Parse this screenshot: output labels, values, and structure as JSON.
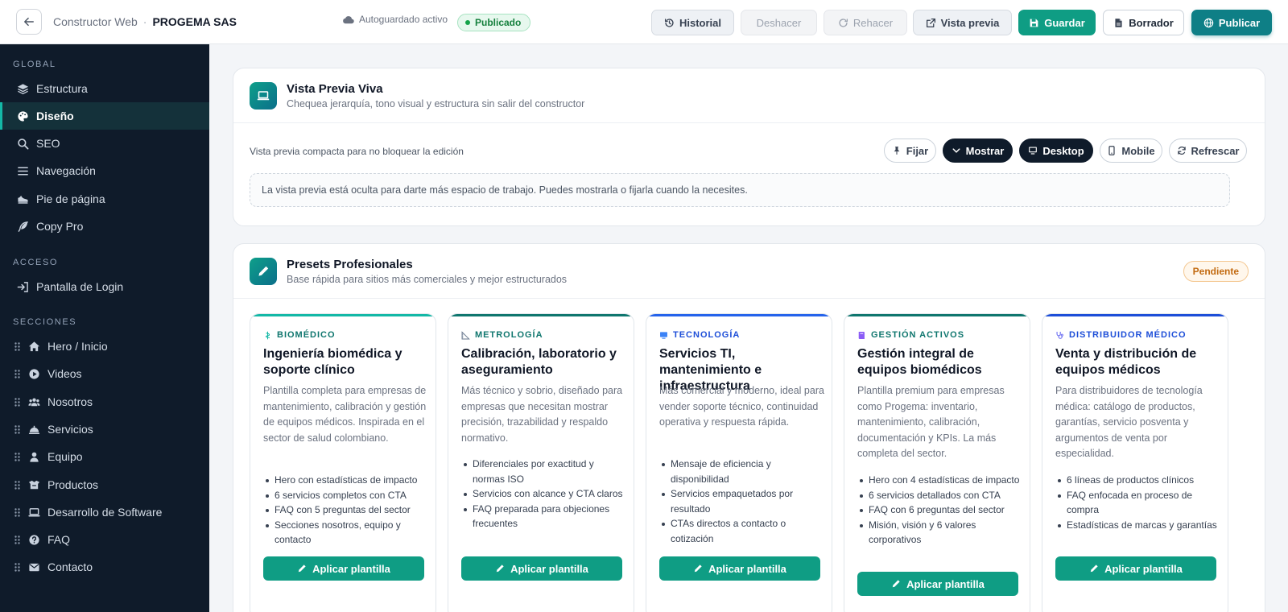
{
  "topbar": {
    "app_name": "Constructor Web",
    "separator": "·",
    "org_name": "PROGEMA SAS",
    "autosave_text": "Autoguardado activo",
    "status_badge": "Publicado",
    "buttons": {
      "history": "Historial",
      "undo": "Deshacer",
      "redo": "Rehacer",
      "preview": "Vista previa",
      "save": "Guardar",
      "draft": "Borrador",
      "publish": "Publicar"
    }
  },
  "sidebar": {
    "global_title": "GLOBAL",
    "global_items": [
      {
        "label": "Estructura",
        "icon": "layers-icon"
      },
      {
        "label": "Diseño",
        "icon": "palette-icon",
        "active": true
      },
      {
        "label": "SEO",
        "icon": "search-icon"
      },
      {
        "label": "Navegación",
        "icon": "menu-icon"
      },
      {
        "label": "Pie de página",
        "icon": "shoe-icon"
      },
      {
        "label": "Copy Pro",
        "icon": "feather-icon"
      }
    ],
    "access_title": "ACCESO",
    "access_items": [
      {
        "label": "Pantalla de Login",
        "icon": "login-icon"
      }
    ],
    "sections_title": "SECCIONES",
    "section_items": [
      {
        "label": "Hero / Inicio",
        "icon": "home-icon"
      },
      {
        "label": "Videos",
        "icon": "play-icon"
      },
      {
        "label": "Nosotros",
        "icon": "users-icon"
      },
      {
        "label": "Servicios",
        "icon": "bell-icon"
      },
      {
        "label": "Equipo",
        "icon": "user-icon"
      },
      {
        "label": "Productos",
        "icon": "box-icon"
      },
      {
        "label": "Desarrollo de Software",
        "icon": "laptop-icon"
      },
      {
        "label": "FAQ",
        "icon": "question-icon"
      },
      {
        "label": "Contacto",
        "icon": "mail-icon"
      }
    ]
  },
  "preview_card": {
    "title": "Vista Previa Viva",
    "subtitle": "Chequea jerarquía, tono visual y estructura sin salir del constructor",
    "compact_label": "Vista previa compacta para no bloquear la edición",
    "buttons": {
      "pin": "Fijar",
      "show": "Mostrar",
      "desktop": "Desktop",
      "mobile": "Mobile",
      "refresh": "Refrescar"
    },
    "hidden_note": "La vista previa está oculta para darte más espacio de trabajo. Puedes mostrarla o fijarla cuando la necesites."
  },
  "presets_card": {
    "title": "Presets Profesionales",
    "subtitle": "Base rápida para sitios más comerciales y mejor estructurados",
    "status": "Pendiente",
    "apply_label": "Aplicar plantilla",
    "templates": [
      {
        "kicker": "BIOMÉDICO",
        "title": "Ingeniería biomédica y soporte clínico",
        "description": "Plantilla completa para empresas de mantenimiento, calibración y gestión de equipos médicos. Inspirada en el sector de salud colombiano.",
        "features": [
          "Hero con estadísticas de impacto",
          "6 servicios completos con CTA",
          "FAQ con 5 preguntas del sector",
          "Secciones nosotros, equipo y contacto"
        ],
        "accent": "#14b8a6"
      },
      {
        "kicker": "METROLOGÍA",
        "title": "Calibración, laboratorio y aseguramiento",
        "description": "Más técnico y sobrio, diseñado para empresas que necesitan mostrar precisión, trazabilidad y respaldo normativo.",
        "features": [
          "Diferenciales por exactitud y normas ISO",
          "Servicios con alcance y CTA claros",
          "FAQ preparada para objeciones frecuentes"
        ],
        "accent": "#0f766e"
      },
      {
        "kicker": "TECNOLOGÍA",
        "title": "Servicios TI, mantenimiento e infraestructura",
        "description": "Más comercial y moderno, ideal para vender soporte técnico, continuidad operativa y respuesta rápida.",
        "features": [
          "Mensaje de eficiencia y disponibilidad",
          "Servicios empaquetados por resultado",
          "CTAs directos a contacto o cotización"
        ],
        "accent": "#2563eb"
      },
      {
        "kicker": "GESTIÓN ACTIVOS",
        "title": "Gestión integral de equipos biomédicos",
        "description": "Plantilla premium para empresas como Progema: inventario, mantenimiento, calibración, documentación y KPIs. La más completa del sector.",
        "features": [
          "Hero con 4 estadísticas de impacto",
          "6 servicios detallados con CTA",
          "FAQ con 6 preguntas del sector",
          "Misión, visión y 6 valores corporativos"
        ],
        "accent": "#0f766e"
      },
      {
        "kicker": "DISTRIBUIDOR MÉDICO",
        "title": "Venta y distribución de equipos médicos",
        "description": "Para distribuidores de tecnología médica: catálogo de productos, garantías, servicio posventa y argumentos de venta por especialidad.",
        "features": [
          "6 líneas de productos clínicos",
          "FAQ enfocada en proceso de compra",
          "Estadísticas de marcas y garantías"
        ],
        "accent": "#1d4ed8"
      }
    ]
  }
}
